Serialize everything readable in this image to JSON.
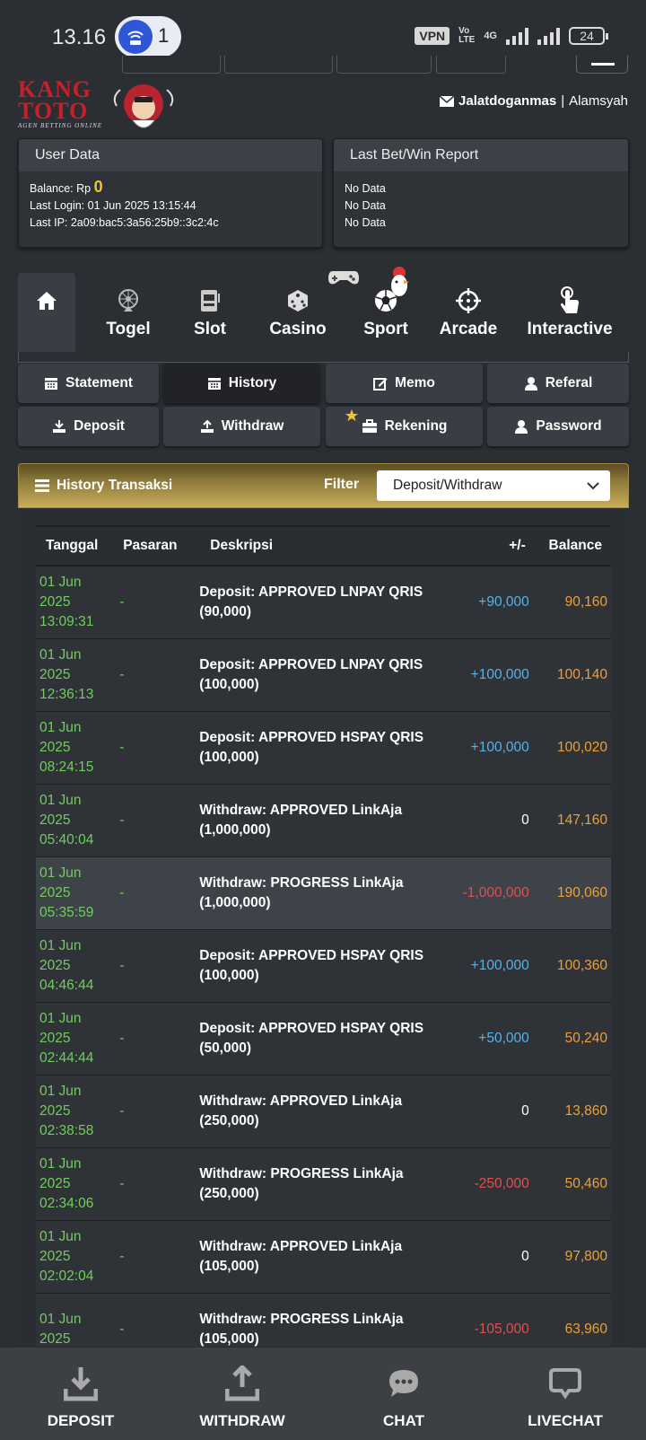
{
  "status_bar": {
    "time": "13.16",
    "notif_count": "1",
    "vpn": "VPN",
    "volte_top": "Vo",
    "volte_bottom": "LTE",
    "network": "4G",
    "battery": "24"
  },
  "header": {
    "logo_line1": "KANG",
    "logo_line2": "TOTO",
    "logo_tagline": "AGEN BETTING ONLINE",
    "username": "Jalatdoganmas",
    "separator": "|",
    "real_name": "Alamsyah"
  },
  "user_data": {
    "title": "User Data",
    "balance_label": "Balance: Rp",
    "balance_value": "0",
    "last_login": "Last Login: 01 Jun 2025 13:15:44",
    "last_ip": "Last IP: 2a09:bac5:3a56:25b9::3c2:4c"
  },
  "last_bet": {
    "title": "Last Bet/Win Report",
    "lines": [
      "No Data",
      "No Data",
      "No Data"
    ]
  },
  "game_tabs": [
    {
      "label": "Togel",
      "icon": "wheel-icon"
    },
    {
      "label": "Slot",
      "icon": "slot-machine-icon"
    },
    {
      "label": "Casino",
      "icon": "dice-icon"
    },
    {
      "label": "Sport",
      "icon": "soccer-ball-icon"
    },
    {
      "label": "Arcade",
      "icon": "crosshair-icon"
    },
    {
      "label": "Interactive",
      "icon": "touch-icon"
    }
  ],
  "menu": {
    "statement": "Statement",
    "history": "History",
    "memo": "Memo",
    "referal": "Referal",
    "deposit": "Deposit",
    "withdraw": "Withdraw",
    "rekening": "Rekening",
    "password": "Password"
  },
  "history": {
    "title": "History Transaksi",
    "filter_label": "Filter",
    "filter_value": "Deposit/Withdraw",
    "columns": [
      "Tanggal",
      "Pasaran",
      "Deskripsi",
      "+/-",
      "Balance"
    ],
    "rows": [
      {
        "d1": "01 Jun",
        "d2": "2025",
        "d3": "13:09:31",
        "pasaran": "-",
        "desc1": "Deposit: APPROVED LNPAY QRIS",
        "desc2": "(90,000)",
        "change": "+90,000",
        "balance": "90,160"
      },
      {
        "d1": "01 Jun",
        "d2": "2025",
        "d3": "12:36:13",
        "pasaran": "-",
        "desc1": "Deposit: APPROVED LNPAY QRIS",
        "desc2": "(100,000)",
        "change": "+100,000",
        "balance": "100,140"
      },
      {
        "d1": "01 Jun",
        "d2": "2025",
        "d3": "08:24:15",
        "pasaran": "-",
        "desc1": "Deposit: APPROVED HSPAY QRIS",
        "desc2": "(100,000)",
        "change": "+100,000",
        "balance": "100,020"
      },
      {
        "d1": "01 Jun",
        "d2": "2025",
        "d3": "05:40:04",
        "pasaran": "-",
        "desc1": "Withdraw: APPROVED LinkAja",
        "desc2": "(1,000,000)",
        "change": "0",
        "balance": "147,160"
      },
      {
        "d1": "01 Jun",
        "d2": "2025",
        "d3": "05:35:59",
        "pasaran": "-",
        "desc1": "Withdraw: PROGRESS LinkAja",
        "desc2": "(1,000,000)",
        "change": "-1,000,000",
        "balance": "190,060"
      },
      {
        "d1": "01 Jun",
        "d2": "2025",
        "d3": "04:46:44",
        "pasaran": "-",
        "desc1": "Deposit: APPROVED HSPAY QRIS",
        "desc2": "(100,000)",
        "change": "+100,000",
        "balance": "100,360"
      },
      {
        "d1": "01 Jun",
        "d2": "2025",
        "d3": "02:44:44",
        "pasaran": "-",
        "desc1": "Deposit: APPROVED HSPAY QRIS",
        "desc2": "(50,000)",
        "change": "+50,000",
        "balance": "50,240"
      },
      {
        "d1": "01 Jun",
        "d2": "2025",
        "d3": "02:38:58",
        "pasaran": "-",
        "desc1": "Withdraw: APPROVED LinkAja",
        "desc2": "(250,000)",
        "change": "0",
        "balance": "13,860"
      },
      {
        "d1": "01 Jun",
        "d2": "2025",
        "d3": "02:34:06",
        "pasaran": "-",
        "desc1": "Withdraw: PROGRESS LinkAja",
        "desc2": "(250,000)",
        "change": "-250,000",
        "balance": "50,460"
      },
      {
        "d1": "01 Jun",
        "d2": "2025",
        "d3": "02:02:04",
        "pasaran": "-",
        "desc1": "Withdraw: APPROVED LinkAja",
        "desc2": "(105,000)",
        "change": "0",
        "balance": "97,800"
      },
      {
        "d1": "01 Jun",
        "d2": "2025",
        "d3": "",
        "pasaran": "-",
        "desc1": "Withdraw: PROGRESS LinkAja",
        "desc2": "(105,000)",
        "change": "-105,000",
        "balance": "63,960"
      }
    ]
  },
  "bottom_nav": {
    "deposit": "DEPOSIT",
    "withdraw": "WITHDRAW",
    "chat": "CHAT",
    "livechat": "LIVECHAT"
  },
  "colors": {
    "background": "#2b2e33",
    "date_green": "#6fcf5a",
    "positive_blue": "#56b3e8",
    "negative_red": "#e05050",
    "balance_orange": "#f0a030",
    "gold_header": "#c8ad5a"
  }
}
